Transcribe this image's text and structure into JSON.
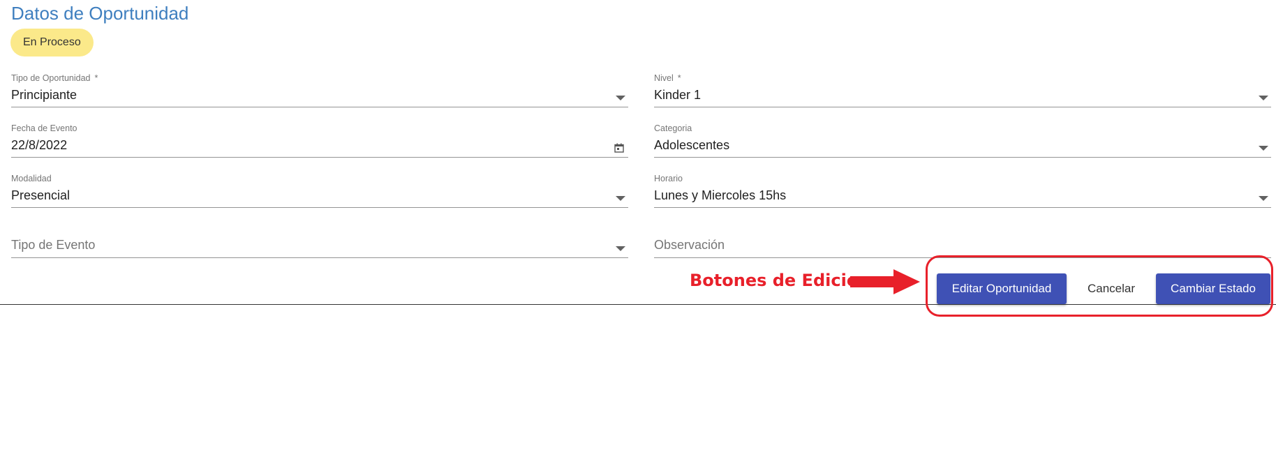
{
  "header": {
    "title": "Datos de Oportunidad",
    "status": "En Proceso"
  },
  "form": {
    "tipo_oportunidad": {
      "label": "Tipo de Oportunidad",
      "required_mark": "*",
      "value": "Principiante"
    },
    "nivel": {
      "label": "Nivel",
      "required_mark": "*",
      "value": "Kinder 1"
    },
    "fecha_evento": {
      "label": "Fecha de Evento",
      "value": "22/8/2022"
    },
    "categoria": {
      "label": "Categoria",
      "value": "Adolescentes"
    },
    "modalidad": {
      "label": "Modalidad",
      "value": "Presencial"
    },
    "horario": {
      "label": "Horario",
      "value": "Lunes y Miercoles 15hs"
    },
    "tipo_evento": {
      "placeholder": "Tipo de Evento"
    },
    "observacion": {
      "placeholder": "Observación"
    }
  },
  "actions": {
    "edit_label": "Editar Oportunidad",
    "cancel_label": "Cancelar",
    "change_state_label": "Cambiar Estado"
  },
  "annotation": {
    "text": "Botones de Edicion",
    "color": "#e8202a"
  },
  "colors": {
    "title": "#3f7fbf",
    "status_chip": "#fbe98a",
    "primary_button": "#3f51b5"
  }
}
